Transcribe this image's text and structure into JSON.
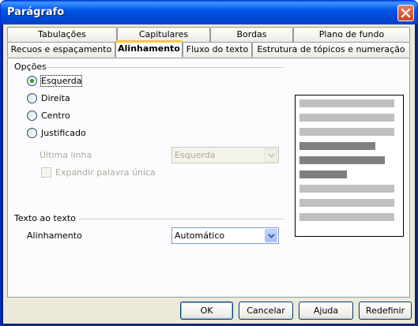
{
  "window": {
    "title": "Parágrafo"
  },
  "tabs_back": [
    "Tabulações",
    "Capitulares",
    "Bordas",
    "Plano de fundo"
  ],
  "tabs_front": [
    "Recuos e espaçamento",
    "Alinhamento",
    "Fluxo do texto",
    "Estrutura de tópicos e numeração"
  ],
  "active_tab": "Alinhamento",
  "options": {
    "heading": "Opções",
    "radio_left": "Esquerda",
    "radio_right": "Direita",
    "radio_center": "Centro",
    "radio_justified": "Justificado",
    "selected": "Esquerda",
    "last_line_label": "Última linha",
    "last_line_value": "Esquerda",
    "expand_word_label": "Expandir palavra única"
  },
  "text_to_text": {
    "heading": "Texto ao texto",
    "alignment_label": "Alinhamento",
    "alignment_value": "Automático"
  },
  "buttons": {
    "ok": "OK",
    "cancel": "Cancelar",
    "help": "Ajuda",
    "reset": "Redefinir"
  },
  "preview_colors": {
    "light": "#C0C0C0",
    "dark": "#808080"
  }
}
